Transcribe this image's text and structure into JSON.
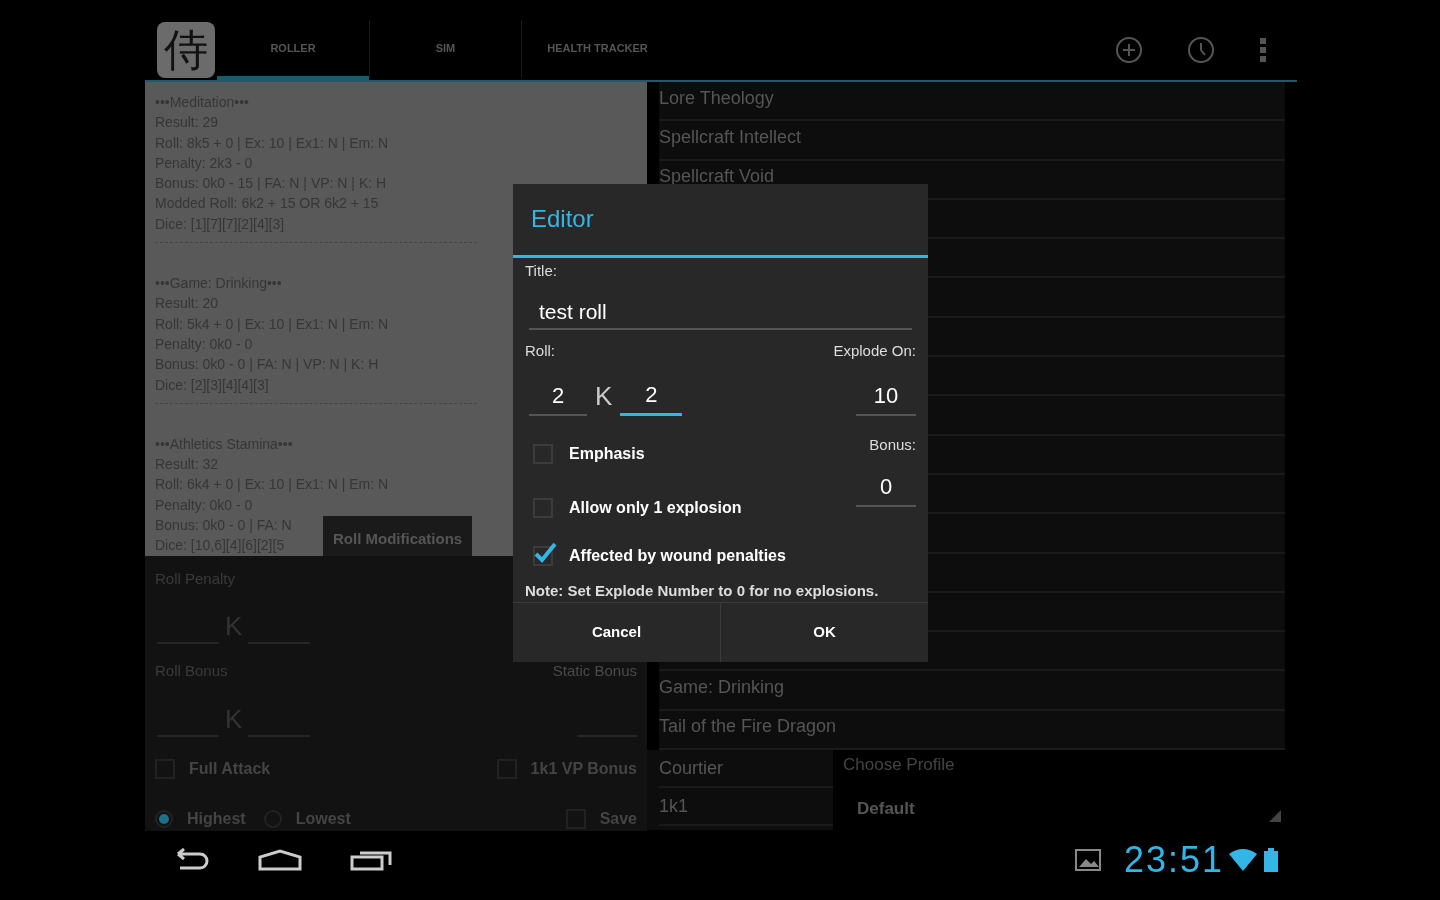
{
  "action_bar": {
    "logo": "侍",
    "tabs": [
      {
        "label": "ROLLER",
        "selected": true
      },
      {
        "label": "SIM",
        "selected": false
      },
      {
        "label": "HEALTH TRACKER",
        "selected": false
      }
    ]
  },
  "roll_log": [
    {
      "lines": [
        "•••Meditation•••",
        "Result: 29",
        "Roll: 8k5 + 0 | Ex: 10 | Ex1: N | Em: N",
        "Penalty: 2k3 - 0",
        "Bonus: 0k0 - 15 | FA: N | VP: N | K: H",
        "Modded Roll: 6k2 + 15 OR 6k2 + 15",
        "Dice: [1][7][7][2][4][3]"
      ]
    },
    {
      "lines": [
        "•••Game: Drinking•••",
        "Result: 20",
        "Roll: 5k4 + 0 | Ex: 10 | Ex1: N | Em: N",
        "Penalty: 0k0 - 0",
        "Bonus: 0k0 - 0 | FA: N | VP: N | K: H",
        "Dice: [2][3][4][4][3]"
      ]
    },
    {
      "lines": [
        "•••Athletics Stamina•••",
        "Result: 32",
        "Roll: 6k4 + 0 | Ex: 10 | Ex1: N | Em: N",
        "Penalty: 0k0 - 0",
        "Bonus: 0k0 - 0 | FA: N",
        "Dice: [10,6][4][6][2][5"
      ]
    }
  ],
  "tooltip": "Roll Modifications",
  "modifications": {
    "penalty_label": "Roll Penalty",
    "bonus_label": "Roll Bonus",
    "static_bonus_label": "Static Bonus",
    "penalty_k": "K",
    "bonus_k": "K",
    "checks": [
      {
        "label": "Full Attack",
        "checked": false
      },
      {
        "label": "1k1 VP Bonus",
        "checked": false
      }
    ],
    "radios": [
      {
        "label": "Highest",
        "selected": true
      },
      {
        "label": "Lowest",
        "selected": false
      }
    ],
    "save": {
      "label": "Save",
      "checked": false
    }
  },
  "roll_list_top": [
    "Lore Theology",
    "Spellcraft Intellect",
    "Spellcraft Void"
  ],
  "roll_list_bottom": [
    "Game: Drinking",
    "Tail of the Fire Dragon"
  ],
  "bottom_list": [
    "Courtier",
    "1k1"
  ],
  "profile": {
    "label": "Choose Profile",
    "value": "Default"
  },
  "dialog": {
    "title": "Editor",
    "title_label": "Title:",
    "title_value": "test roll",
    "roll_label": "Roll:",
    "explode_label": "Explode On:",
    "dice": "2",
    "k": "K",
    "keep": "2",
    "explode": "10",
    "bonus_label": "Bonus:",
    "bonus": "0",
    "options": [
      {
        "label": "Emphasis",
        "checked": false
      },
      {
        "label": "Allow only 1 explosion",
        "checked": false
      },
      {
        "label": "Affected by wound penalties",
        "checked": true
      }
    ],
    "note": "Note: Set Explode Number to 0 for no explosions.",
    "buttons": [
      "Cancel",
      "OK"
    ]
  },
  "status_bar": {
    "time": "23:51"
  }
}
